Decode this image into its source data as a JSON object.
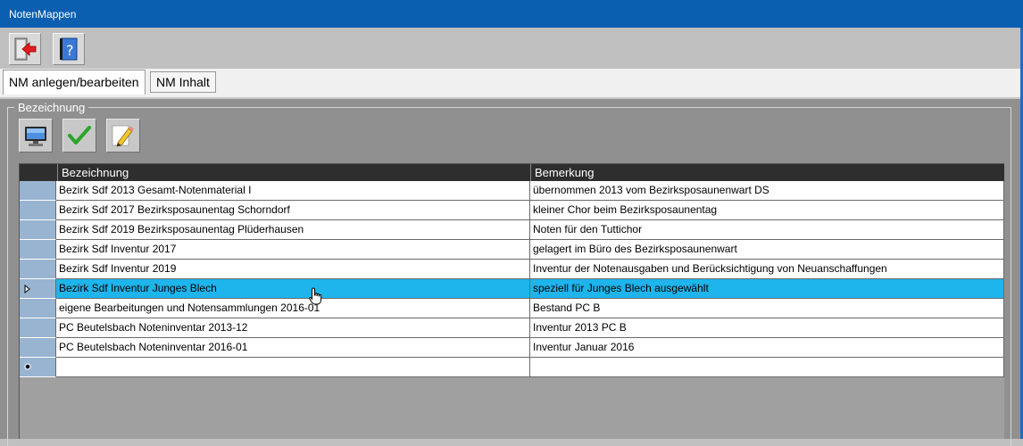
{
  "window": {
    "title": "NotenMappen"
  },
  "toolbar": {
    "exit_icon": "exit-door-icon",
    "help_icon": "help-book-icon"
  },
  "tabs": [
    {
      "label": "NM anlegen/bearbeiten",
      "active": true
    },
    {
      "label": "NM Inhalt",
      "active": false
    }
  ],
  "group": {
    "label": "Bezeichnung",
    "buttons": [
      {
        "icon": "monitor-icon"
      },
      {
        "icon": "checkmark-icon"
      },
      {
        "icon": "pencil-icon"
      }
    ]
  },
  "grid": {
    "columns": [
      "Bezeichnung",
      "Bemerkung"
    ],
    "selected_index": 5,
    "rows": [
      {
        "bezeichnung": "Bezirk Sdf 2013 Gesamt-Notenmaterial I",
        "bemerkung": "übernommen 2013 vom Bezirksposaunenwart DS"
      },
      {
        "bezeichnung": "Bezirk Sdf 2017 Bezirksposaunentag Schorndorf",
        "bemerkung": "kleiner Chor beim Bezirksposaunentag"
      },
      {
        "bezeichnung": "Bezirk Sdf 2019 Bezirksposaunentag Plüderhausen",
        "bemerkung": "Noten für den Tuttichor"
      },
      {
        "bezeichnung": "Bezirk Sdf Inventur 2017",
        "bemerkung": "gelagert im Büro des Bezirksposaunenwart"
      },
      {
        "bezeichnung": "Bezirk Sdf Inventur 2019",
        "bemerkung": "Inventur der Notenausgaben und Berücksichtigung von Neuanschaffungen"
      },
      {
        "bezeichnung": "Bezirk Sdf Inventur Junges Blech",
        "bemerkung": "speziell für Junges Blech ausgewählt"
      },
      {
        "bezeichnung": "eigene Bearbeitungen und Notensammlungen 2016-01",
        "bemerkung": "Bestand PC B"
      },
      {
        "bezeichnung": "PC Beutelsbach Noteninventar  2013-12",
        "bemerkung": "Inventur 2013 PC B"
      },
      {
        "bezeichnung": "PC Beutelsbach Noteninventar 2016-01",
        "bemerkung": " Inventur Januar 2016"
      }
    ]
  }
}
